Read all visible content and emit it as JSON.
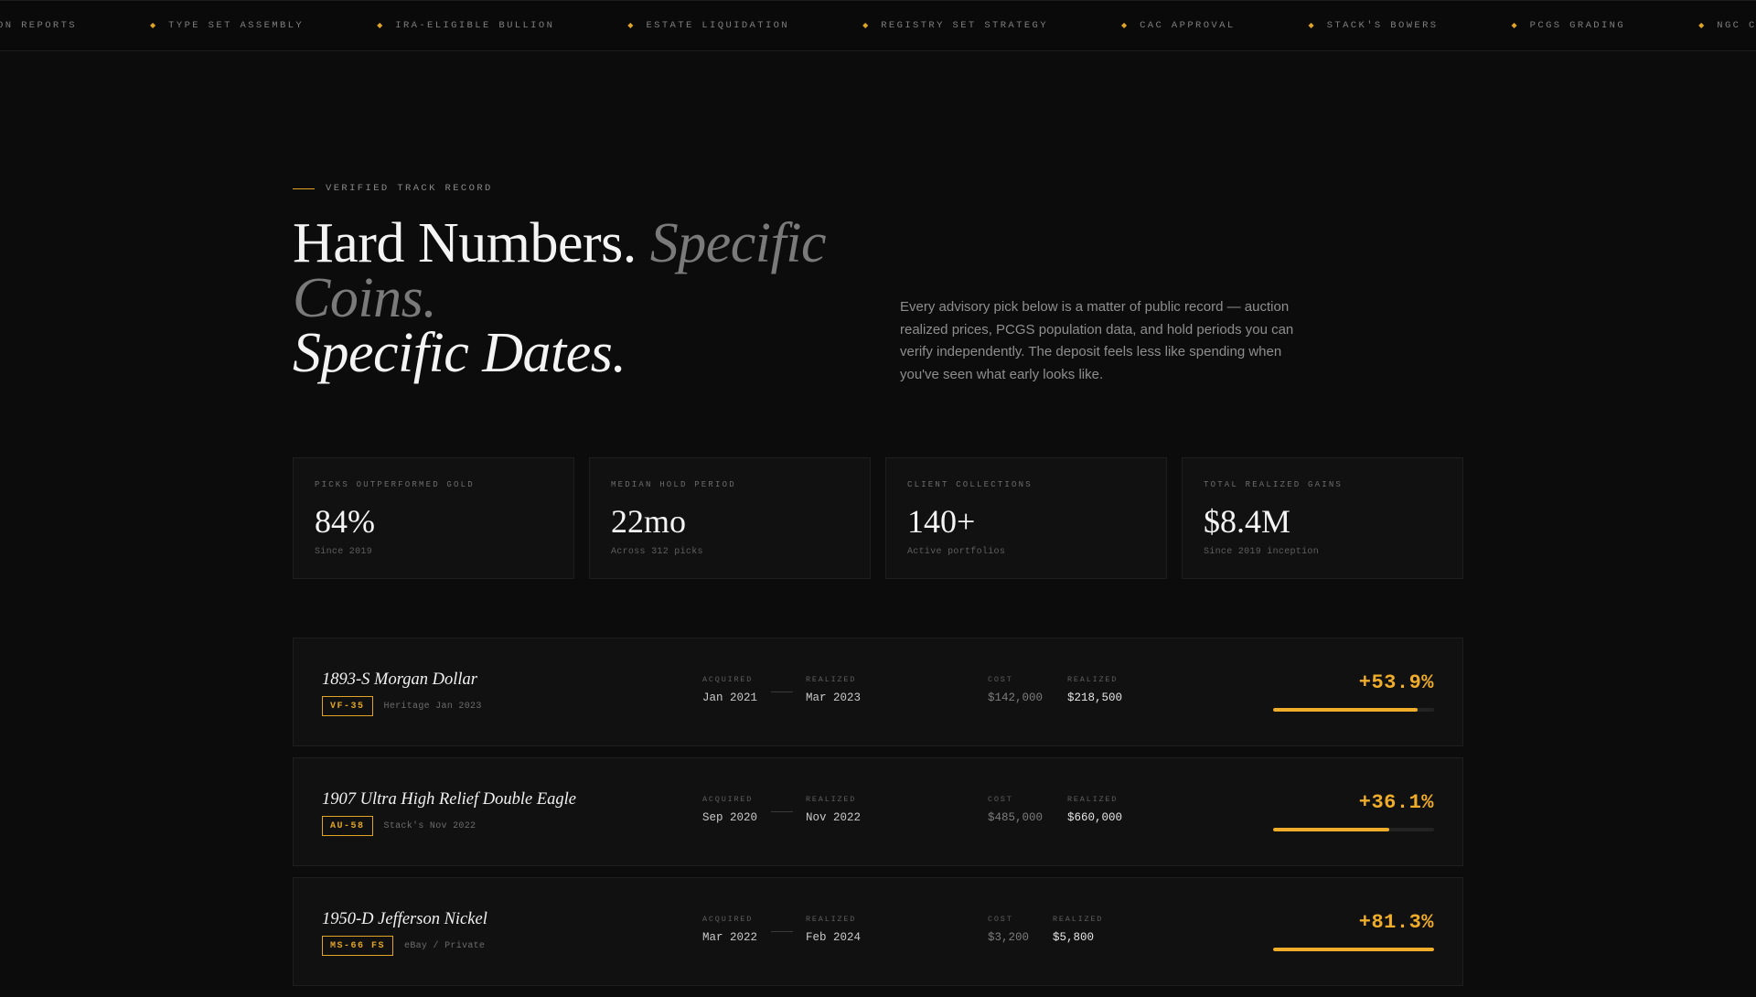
{
  "ticker": {
    "items": [
      "ON REPORTS",
      "TYPE SET ASSEMBLY",
      "IRA-ELIGIBLE BULLION",
      "ESTATE LIQUIDATION",
      "REGISTRY SET STRATEGY",
      "CAC APPROVAL",
      "STACK'S BOWERS",
      "PCGS GRADING",
      "NGC CERTIF"
    ]
  },
  "header": {
    "eyebrow": "VERIFIED TRACK RECORD",
    "title_part1": "Hard Numbers.",
    "title_part2": "Specific Coins.",
    "title_part3": "Specific Dates.",
    "lede": "Every advisory pick below is a matter of public record — auction realized prices, PCGS population data, and hold periods you can verify independently. The deposit feels less like spending when you've seen what early looks like."
  },
  "stats": [
    {
      "label": "PICKS OUTPERFORMED GOLD",
      "value": "84%",
      "sub": "Since 2019"
    },
    {
      "label": "MEDIAN HOLD PERIOD",
      "value": "22mo",
      "sub": "Across 312 picks"
    },
    {
      "label": "CLIENT COLLECTIONS",
      "value": "140+",
      "sub": "Active portfolios"
    },
    {
      "label": "TOTAL REALIZED GAINS",
      "value": "$8.4M",
      "sub": "Since 2019 inception"
    }
  ],
  "column_labels": {
    "acquired": "ACQUIRED",
    "realized": "REALIZED",
    "cost": "COST",
    "realized_price": "REALIZED"
  },
  "picks": [
    {
      "name": "1893-S Morgan Dollar",
      "grade": "VF-35",
      "source": "Heritage Jan 2023",
      "acquired": "Jan 2021",
      "realized": "Mar 2023",
      "cost": "$142,000",
      "realized_price": "$218,500",
      "gain": "+53.9%",
      "bar_fraction": 0.9
    },
    {
      "name": "1907 Ultra High Relief Double Eagle",
      "grade": "AU-58",
      "source": "Stack's Nov 2022",
      "acquired": "Sep 2020",
      "realized": "Nov 2022",
      "cost": "$485,000",
      "realized_price": "$660,000",
      "gain": "+36.1%",
      "bar_fraction": 0.72
    },
    {
      "name": "1950-D Jefferson Nickel",
      "grade": "MS-66 FS",
      "source": "eBay / Private",
      "acquired": "Mar 2022",
      "realized": "Feb 2024",
      "cost": "$3,200",
      "realized_price": "$5,800",
      "gain": "+81.3%",
      "bar_fraction": 1.0
    }
  ],
  "colors": {
    "accent": "#f0ad2a",
    "background": "#0c0c0c",
    "card": "#111111"
  }
}
